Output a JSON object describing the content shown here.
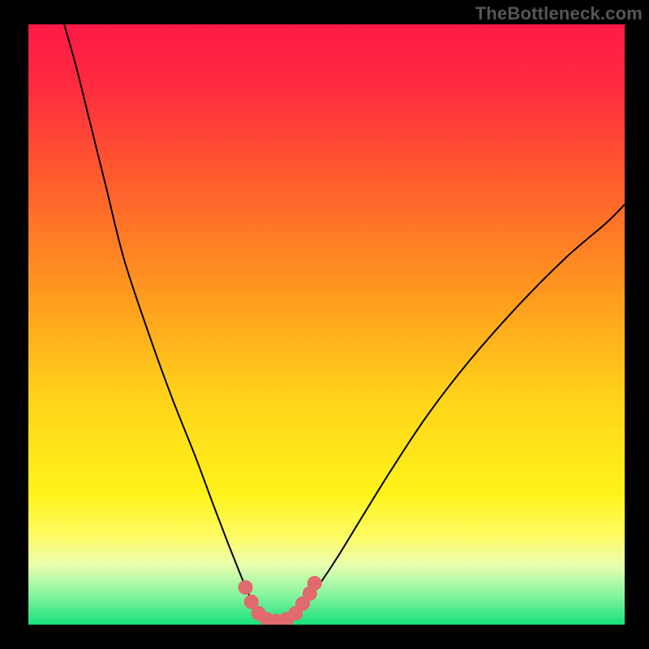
{
  "watermark": "TheBottleneck.com",
  "chart_data": {
    "type": "line",
    "title": "",
    "xlabel": "",
    "ylabel": "",
    "xlim": [
      0,
      100
    ],
    "ylim": [
      0,
      100
    ],
    "grid": false,
    "legend": false,
    "gradient_stops": [
      {
        "offset": 0.0,
        "color": "#ff1a47"
      },
      {
        "offset": 0.1,
        "color": "#ff2a3f"
      },
      {
        "offset": 0.25,
        "color": "#ff5a2e"
      },
      {
        "offset": 0.45,
        "color": "#ff9a1e"
      },
      {
        "offset": 0.62,
        "color": "#ffd21a"
      },
      {
        "offset": 0.78,
        "color": "#fff31a"
      },
      {
        "offset": 0.85,
        "color": "#fffb60"
      },
      {
        "offset": 0.9,
        "color": "#eaffb0"
      },
      {
        "offset": 0.95,
        "color": "#88f5a0"
      },
      {
        "offset": 1.0,
        "color": "#18e07a"
      }
    ],
    "series": [
      {
        "name": "bottleneck-curve",
        "color": "#000000",
        "points": [
          {
            "x": 6.0,
            "y": 100.0
          },
          {
            "x": 8.0,
            "y": 93.0
          },
          {
            "x": 10.0,
            "y": 85.0
          },
          {
            "x": 13.0,
            "y": 73.0
          },
          {
            "x": 16.0,
            "y": 61.0
          },
          {
            "x": 20.0,
            "y": 49.0
          },
          {
            "x": 24.0,
            "y": 38.0
          },
          {
            "x": 28.0,
            "y": 28.0
          },
          {
            "x": 31.0,
            "y": 20.0
          },
          {
            "x": 33.5,
            "y": 13.5
          },
          {
            "x": 35.5,
            "y": 8.5
          },
          {
            "x": 37.0,
            "y": 5.0
          },
          {
            "x": 38.2,
            "y": 2.6
          },
          {
            "x": 39.2,
            "y": 1.4
          },
          {
            "x": 40.2,
            "y": 0.8
          },
          {
            "x": 41.5,
            "y": 0.6
          },
          {
            "x": 43.0,
            "y": 0.8
          },
          {
            "x": 44.2,
            "y": 1.4
          },
          {
            "x": 45.5,
            "y": 2.6
          },
          {
            "x": 47.0,
            "y": 4.5
          },
          {
            "x": 49.0,
            "y": 7.0
          },
          {
            "x": 52.0,
            "y": 11.5
          },
          {
            "x": 56.0,
            "y": 18.0
          },
          {
            "x": 61.0,
            "y": 26.0
          },
          {
            "x": 67.0,
            "y": 35.0
          },
          {
            "x": 74.0,
            "y": 44.0
          },
          {
            "x": 82.0,
            "y": 53.0
          },
          {
            "x": 90.0,
            "y": 61.0
          },
          {
            "x": 97.0,
            "y": 67.0
          },
          {
            "x": 100.0,
            "y": 70.0
          }
        ]
      }
    ],
    "markers": {
      "color": "#e06a6d",
      "radius_px": 9,
      "points": [
        {
          "x": 36.4,
          "y": 6.2
        },
        {
          "x": 37.4,
          "y": 3.8
        },
        {
          "x": 38.6,
          "y": 1.9
        },
        {
          "x": 40.0,
          "y": 0.9
        },
        {
          "x": 41.6,
          "y": 0.6
        },
        {
          "x": 43.3,
          "y": 0.9
        },
        {
          "x": 44.8,
          "y": 1.9
        },
        {
          "x": 46.0,
          "y": 3.5
        },
        {
          "x": 47.2,
          "y": 5.2
        },
        {
          "x": 48.0,
          "y": 6.9
        }
      ]
    }
  }
}
